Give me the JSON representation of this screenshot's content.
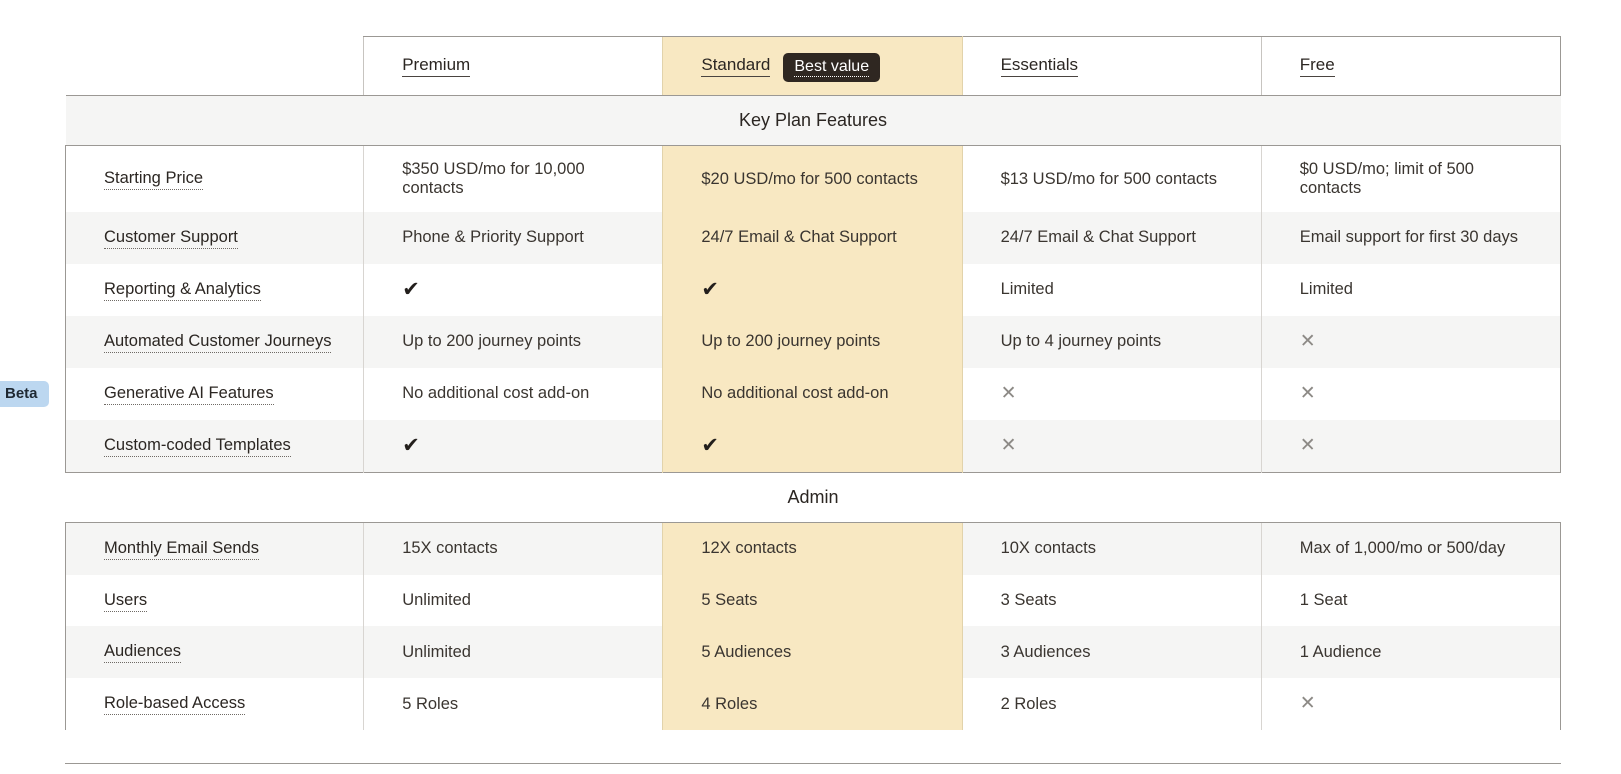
{
  "table": {
    "columns": [
      {
        "key": "label",
        "name": "",
        "highlight": false,
        "badge": null
      },
      {
        "key": "premium",
        "name": "Premium",
        "highlight": false,
        "badge": null
      },
      {
        "key": "standard",
        "name": "Standard",
        "highlight": true,
        "badge": "Best value"
      },
      {
        "key": "essentials",
        "name": "Essentials",
        "highlight": false,
        "badge": null
      },
      {
        "key": "free",
        "name": "Free",
        "highlight": false,
        "badge": null
      }
    ],
    "sections": [
      {
        "title": "Key Plan Features",
        "rows": [
          {
            "label": "Starting Price",
            "badge": null,
            "values": [
              "$350 USD/mo for 10,000 contacts",
              "$20 USD/mo for 500 contacts",
              "$13 USD/mo for 500 contacts",
              "$0 USD/mo; limit of 500 contacts"
            ]
          },
          {
            "label": "Customer Support",
            "badge": null,
            "values": [
              "Phone & Priority Support",
              "24/7 Email & Chat Support",
              "24/7 Email & Chat Support",
              "Email support for first 30 days"
            ]
          },
          {
            "label": "Reporting & Analytics",
            "badge": null,
            "values": [
              "check",
              "check",
              "Limited",
              "Limited"
            ]
          },
          {
            "label": "Automated Customer Journeys",
            "badge": null,
            "values": [
              "Up to 200 journey points",
              "Up to 200 journey points",
              "Up to 4 journey points",
              "cross"
            ]
          },
          {
            "label": "Generative AI Features",
            "badge": "Beta",
            "values": [
              "No additional cost add-on",
              "No additional cost add-on",
              "cross",
              "cross"
            ]
          },
          {
            "label": "Custom-coded Templates",
            "badge": null,
            "values": [
              "check",
              "check",
              "cross",
              "cross"
            ]
          }
        ]
      },
      {
        "title": "Admin",
        "rows": [
          {
            "label": "Monthly Email Sends",
            "badge": null,
            "values": [
              "15X contacts",
              "12X contacts",
              "10X contacts",
              "Max of 1,000/mo or 500/day"
            ]
          },
          {
            "label": "Users",
            "badge": null,
            "values": [
              "Unlimited",
              "5 Seats",
              "3 Seats",
              "1 Seat"
            ]
          },
          {
            "label": "Audiences",
            "badge": null,
            "values": [
              "Unlimited",
              "5 Audiences",
              "3 Audiences",
              "1 Audience"
            ]
          },
          {
            "label": "Role-based Access",
            "badge": null,
            "values": [
              "5 Roles",
              "4 Roles",
              "2 Roles",
              "cross"
            ]
          }
        ]
      }
    ],
    "icons": {
      "check": "✔",
      "cross": "✕"
    },
    "colors": {
      "highlight_background": "#f8e8c2",
      "badge_best_value_background": "#2f2721",
      "badge_beta_background": "#bcd7f0",
      "row_stripe": "#f5f5f4",
      "border": "#9b9894",
      "cross_icon": "#8d8a86"
    }
  }
}
